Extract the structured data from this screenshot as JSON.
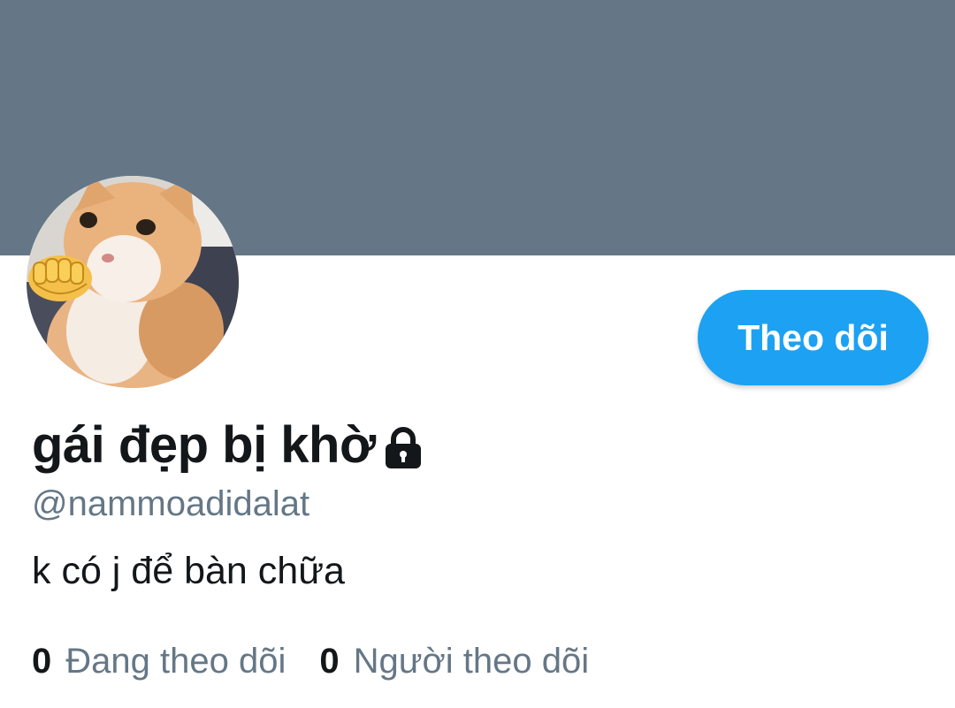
{
  "profile": {
    "display_name": "gái đẹp bị khờ",
    "handle": "@nammoadidalat",
    "bio": "k có j để bàn chữa",
    "protected_icon": "lock-icon",
    "avatar_icon": "avatar-photo"
  },
  "actions": {
    "follow_label": "Theo dõi"
  },
  "stats": {
    "following_count": "0",
    "following_label": "Đang theo dõi",
    "followers_count": "0",
    "followers_label": "Người theo dõi"
  },
  "colors": {
    "banner": "#657786",
    "accent": "#1da1f2",
    "text_primary": "#14171a",
    "text_secondary": "#657786"
  }
}
